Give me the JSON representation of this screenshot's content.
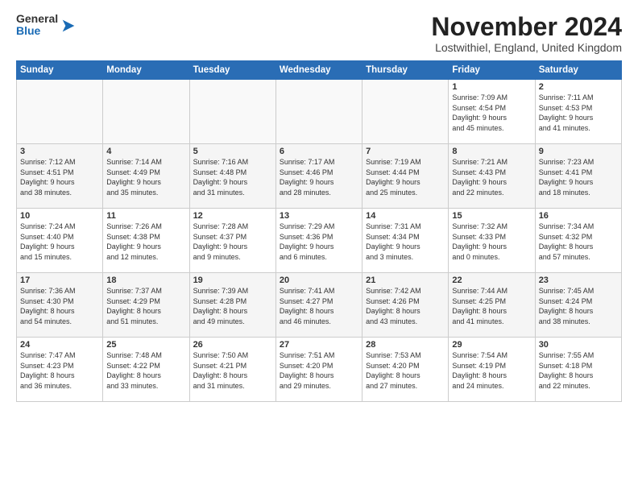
{
  "header": {
    "logo": {
      "general": "General",
      "blue": "Blue"
    },
    "title": "November 2024",
    "location": "Lostwithiel, England, United Kingdom"
  },
  "calendar": {
    "days_of_week": [
      "Sunday",
      "Monday",
      "Tuesday",
      "Wednesday",
      "Thursday",
      "Friday",
      "Saturday"
    ],
    "weeks": [
      [
        {
          "day": "",
          "info": ""
        },
        {
          "day": "",
          "info": ""
        },
        {
          "day": "",
          "info": ""
        },
        {
          "day": "",
          "info": ""
        },
        {
          "day": "",
          "info": ""
        },
        {
          "day": "1",
          "info": "Sunrise: 7:09 AM\nSunset: 4:54 PM\nDaylight: 9 hours\nand 45 minutes."
        },
        {
          "day": "2",
          "info": "Sunrise: 7:11 AM\nSunset: 4:53 PM\nDaylight: 9 hours\nand 41 minutes."
        }
      ],
      [
        {
          "day": "3",
          "info": "Sunrise: 7:12 AM\nSunset: 4:51 PM\nDaylight: 9 hours\nand 38 minutes."
        },
        {
          "day": "4",
          "info": "Sunrise: 7:14 AM\nSunset: 4:49 PM\nDaylight: 9 hours\nand 35 minutes."
        },
        {
          "day": "5",
          "info": "Sunrise: 7:16 AM\nSunset: 4:48 PM\nDaylight: 9 hours\nand 31 minutes."
        },
        {
          "day": "6",
          "info": "Sunrise: 7:17 AM\nSunset: 4:46 PM\nDaylight: 9 hours\nand 28 minutes."
        },
        {
          "day": "7",
          "info": "Sunrise: 7:19 AM\nSunset: 4:44 PM\nDaylight: 9 hours\nand 25 minutes."
        },
        {
          "day": "8",
          "info": "Sunrise: 7:21 AM\nSunset: 4:43 PM\nDaylight: 9 hours\nand 22 minutes."
        },
        {
          "day": "9",
          "info": "Sunrise: 7:23 AM\nSunset: 4:41 PM\nDaylight: 9 hours\nand 18 minutes."
        }
      ],
      [
        {
          "day": "10",
          "info": "Sunrise: 7:24 AM\nSunset: 4:40 PM\nDaylight: 9 hours\nand 15 minutes."
        },
        {
          "day": "11",
          "info": "Sunrise: 7:26 AM\nSunset: 4:38 PM\nDaylight: 9 hours\nand 12 minutes."
        },
        {
          "day": "12",
          "info": "Sunrise: 7:28 AM\nSunset: 4:37 PM\nDaylight: 9 hours\nand 9 minutes."
        },
        {
          "day": "13",
          "info": "Sunrise: 7:29 AM\nSunset: 4:36 PM\nDaylight: 9 hours\nand 6 minutes."
        },
        {
          "day": "14",
          "info": "Sunrise: 7:31 AM\nSunset: 4:34 PM\nDaylight: 9 hours\nand 3 minutes."
        },
        {
          "day": "15",
          "info": "Sunrise: 7:32 AM\nSunset: 4:33 PM\nDaylight: 9 hours\nand 0 minutes."
        },
        {
          "day": "16",
          "info": "Sunrise: 7:34 AM\nSunset: 4:32 PM\nDaylight: 8 hours\nand 57 minutes."
        }
      ],
      [
        {
          "day": "17",
          "info": "Sunrise: 7:36 AM\nSunset: 4:30 PM\nDaylight: 8 hours\nand 54 minutes."
        },
        {
          "day": "18",
          "info": "Sunrise: 7:37 AM\nSunset: 4:29 PM\nDaylight: 8 hours\nand 51 minutes."
        },
        {
          "day": "19",
          "info": "Sunrise: 7:39 AM\nSunset: 4:28 PM\nDaylight: 8 hours\nand 49 minutes."
        },
        {
          "day": "20",
          "info": "Sunrise: 7:41 AM\nSunset: 4:27 PM\nDaylight: 8 hours\nand 46 minutes."
        },
        {
          "day": "21",
          "info": "Sunrise: 7:42 AM\nSunset: 4:26 PM\nDaylight: 8 hours\nand 43 minutes."
        },
        {
          "day": "22",
          "info": "Sunrise: 7:44 AM\nSunset: 4:25 PM\nDaylight: 8 hours\nand 41 minutes."
        },
        {
          "day": "23",
          "info": "Sunrise: 7:45 AM\nSunset: 4:24 PM\nDaylight: 8 hours\nand 38 minutes."
        }
      ],
      [
        {
          "day": "24",
          "info": "Sunrise: 7:47 AM\nSunset: 4:23 PM\nDaylight: 8 hours\nand 36 minutes."
        },
        {
          "day": "25",
          "info": "Sunrise: 7:48 AM\nSunset: 4:22 PM\nDaylight: 8 hours\nand 33 minutes."
        },
        {
          "day": "26",
          "info": "Sunrise: 7:50 AM\nSunset: 4:21 PM\nDaylight: 8 hours\nand 31 minutes."
        },
        {
          "day": "27",
          "info": "Sunrise: 7:51 AM\nSunset: 4:20 PM\nDaylight: 8 hours\nand 29 minutes."
        },
        {
          "day": "28",
          "info": "Sunrise: 7:53 AM\nSunset: 4:20 PM\nDaylight: 8 hours\nand 27 minutes."
        },
        {
          "day": "29",
          "info": "Sunrise: 7:54 AM\nSunset: 4:19 PM\nDaylight: 8 hours\nand 24 minutes."
        },
        {
          "day": "30",
          "info": "Sunrise: 7:55 AM\nSunset: 4:18 PM\nDaylight: 8 hours\nand 22 minutes."
        }
      ]
    ]
  }
}
